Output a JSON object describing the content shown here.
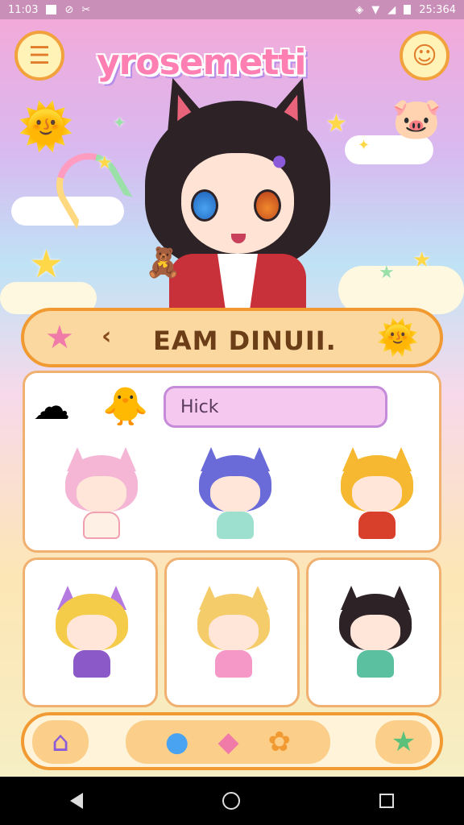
{
  "status_bar": {
    "time": "11:03",
    "right_text": "25:364",
    "icons": [
      "notification-icon",
      "sync-icon",
      "bug-icon",
      "vibrate-icon",
      "wifi-icon",
      "signal-icon",
      "battery-icon"
    ]
  },
  "header": {
    "app_logo_text": "yrosemetti",
    "menu_icon": "menu-face-icon",
    "profile_icon": "profile-face-icon"
  },
  "search_header": {
    "back_glyph": "‹",
    "title": "EAM DINUII.",
    "left_icon": "pink-star-face-icon",
    "right_icon": "sun-face-icon"
  },
  "search": {
    "value": "Hick",
    "placeholder": ""
  },
  "characters_featured": [
    {
      "name": "pink-cat-chibi",
      "hair": "#f5b6d6",
      "ear": "#f5b6d6",
      "body": "#fff0e6"
    },
    {
      "name": "blue-cat-chibi",
      "hair": "#6a6ad8",
      "ear": "#6a6ad8",
      "body": "#9ee0d0"
    },
    {
      "name": "orange-cat-chibi",
      "hair": "#f5b830",
      "ear": "#f5b830",
      "body": "#d8402c"
    }
  ],
  "characters_grid": [
    {
      "name": "blonde-purple-ears-chibi",
      "hair": "#f5cc4a",
      "ear": "#b57ae0",
      "body": "#8c5ac8"
    },
    {
      "name": "blonde-cat-chibi",
      "hair": "#f5cc6a",
      "ear": "#f5cc6a",
      "body": "#f598c8"
    },
    {
      "name": "dark-hair-chibi",
      "hair": "#2d2327",
      "ear": "#2d2327",
      "body": "#5ac0a0"
    }
  ],
  "dock": {
    "items": [
      {
        "name": "home-tab",
        "icon": "house-icon"
      },
      {
        "name": "chat-tab",
        "icon": "balloon-icon"
      },
      {
        "name": "paint-tab",
        "icon": "paint-drop-icon"
      },
      {
        "name": "friends-tab",
        "icon": "bee-face-icon"
      },
      {
        "name": "favorites-tab",
        "icon": "star-icon"
      }
    ]
  },
  "colors": {
    "accent_orange": "#f29a32",
    "panel_border": "#f0b070",
    "search_fill": "#f5c8ef",
    "logo_pink": "#ff7fb3"
  }
}
